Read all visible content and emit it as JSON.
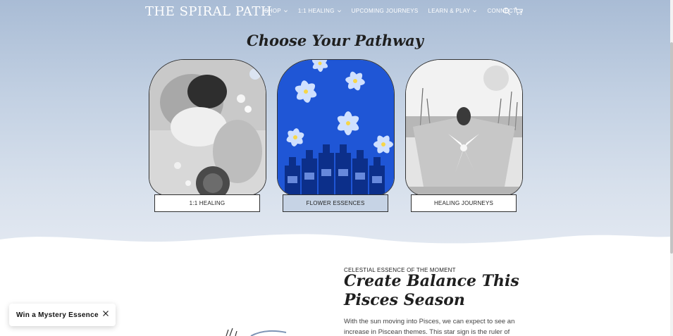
{
  "header": {
    "logo": "THE SPIRAL PATH",
    "nav": [
      {
        "label": "SHOP",
        "has_dropdown": true
      },
      {
        "label": "1:1 HEALING",
        "has_dropdown": true
      },
      {
        "label": "UPCOMING JOURNEYS",
        "has_dropdown": false
      },
      {
        "label": "LEARN & PLAY",
        "has_dropdown": true
      },
      {
        "label": "CONNECT",
        "has_dropdown": true
      }
    ],
    "icons": [
      "search-icon",
      "cart-icon"
    ]
  },
  "pathways": {
    "title": "Choose Your Pathway",
    "cards": [
      {
        "label": "1:1 HEALING",
        "image": "woman-with-flowers-bw",
        "active": false
      },
      {
        "label": "FLOWER ESSENCES",
        "image": "blue-flowers-and-bottles",
        "active": true
      },
      {
        "label": "HEALING JOURNEYS",
        "image": "woman-with-cape-bw",
        "active": false
      }
    ]
  },
  "feature": {
    "eyebrow": "CELESTIAL ESSENCE OF THE MOMENT",
    "headline": "Create Balance This Pisces Season",
    "body": "With the sun moving into Pisces, we can expect to see an increase in Piscean themes. This star sign is the ruler of"
  },
  "popup": {
    "text": "Win a Mystery Essence",
    "close_icon": "close-icon"
  },
  "colors": {
    "hero_top": "#a9bcd5",
    "hero_bottom": "#e2e8f1",
    "active_button": "#c6d3e5",
    "essence_blue": "#1f56d6"
  }
}
